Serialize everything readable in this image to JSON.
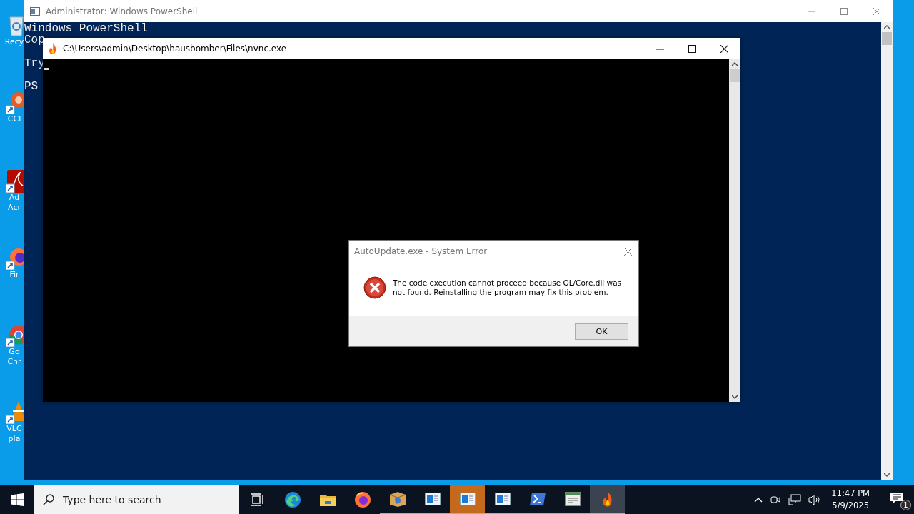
{
  "desktop_icons": [
    {
      "kind": "recycle",
      "shortcut": false,
      "lines": [
        "Recy"
      ]
    },
    {
      "kind": "ccleaner",
      "shortcut": true,
      "lines": [
        "CCl"
      ]
    },
    {
      "kind": "acrobat",
      "shortcut": true,
      "lines": [
        "Ad",
        "Acr"
      ]
    },
    {
      "kind": "firefox",
      "shortcut": true,
      "lines": [
        "Fir"
      ]
    },
    {
      "kind": "chrome",
      "shortcut": true,
      "lines": [
        "Go",
        "Chr"
      ]
    },
    {
      "kind": "vlc",
      "shortcut": true,
      "lines": [
        "VLC",
        "pla"
      ]
    }
  ],
  "powershell_window": {
    "title": "Administrator: Windows PowerShell",
    "paragraphs": [
      [
        "Windows PowerShell",
        "Cop"
      ],
      [
        "Try"
      ],
      [
        "PS"
      ]
    ]
  },
  "console_window": {
    "title": "C:\\Users\\admin\\Desktop\\hausbomber\\Files\\nvnc.exe"
  },
  "error_dialog": {
    "title": "AutoUpdate.exe - System Error",
    "message": "The code execution cannot proceed because QL/Core.dll was not found. Reinstalling the program may fix this problem.",
    "button": "OK"
  },
  "taskbar": {
    "search_placeholder": "Type here to search",
    "apps": [
      {
        "kind": "taskview",
        "running": false,
        "flashing": false,
        "selected": false
      },
      {
        "kind": "edge",
        "running": false,
        "flashing": false,
        "selected": false
      },
      {
        "kind": "explorer",
        "running": false,
        "flashing": false,
        "selected": false
      },
      {
        "kind": "firefox",
        "running": false,
        "flashing": false,
        "selected": false
      },
      {
        "kind": "package",
        "running": true,
        "flashing": false,
        "selected": false
      },
      {
        "kind": "window",
        "running": true,
        "flashing": false,
        "selected": false
      },
      {
        "kind": "window",
        "running": true,
        "flashing": true,
        "selected": false
      },
      {
        "kind": "window",
        "running": true,
        "flashing": false,
        "selected": false
      },
      {
        "kind": "powershell",
        "running": true,
        "flashing": false,
        "selected": false
      },
      {
        "kind": "editor",
        "running": true,
        "flashing": false,
        "selected": false
      },
      {
        "kind": "fire",
        "running": true,
        "flashing": false,
        "selected": true
      }
    ],
    "time": "11:47 PM",
    "date": "5/9/2025",
    "notification_count": "1"
  }
}
